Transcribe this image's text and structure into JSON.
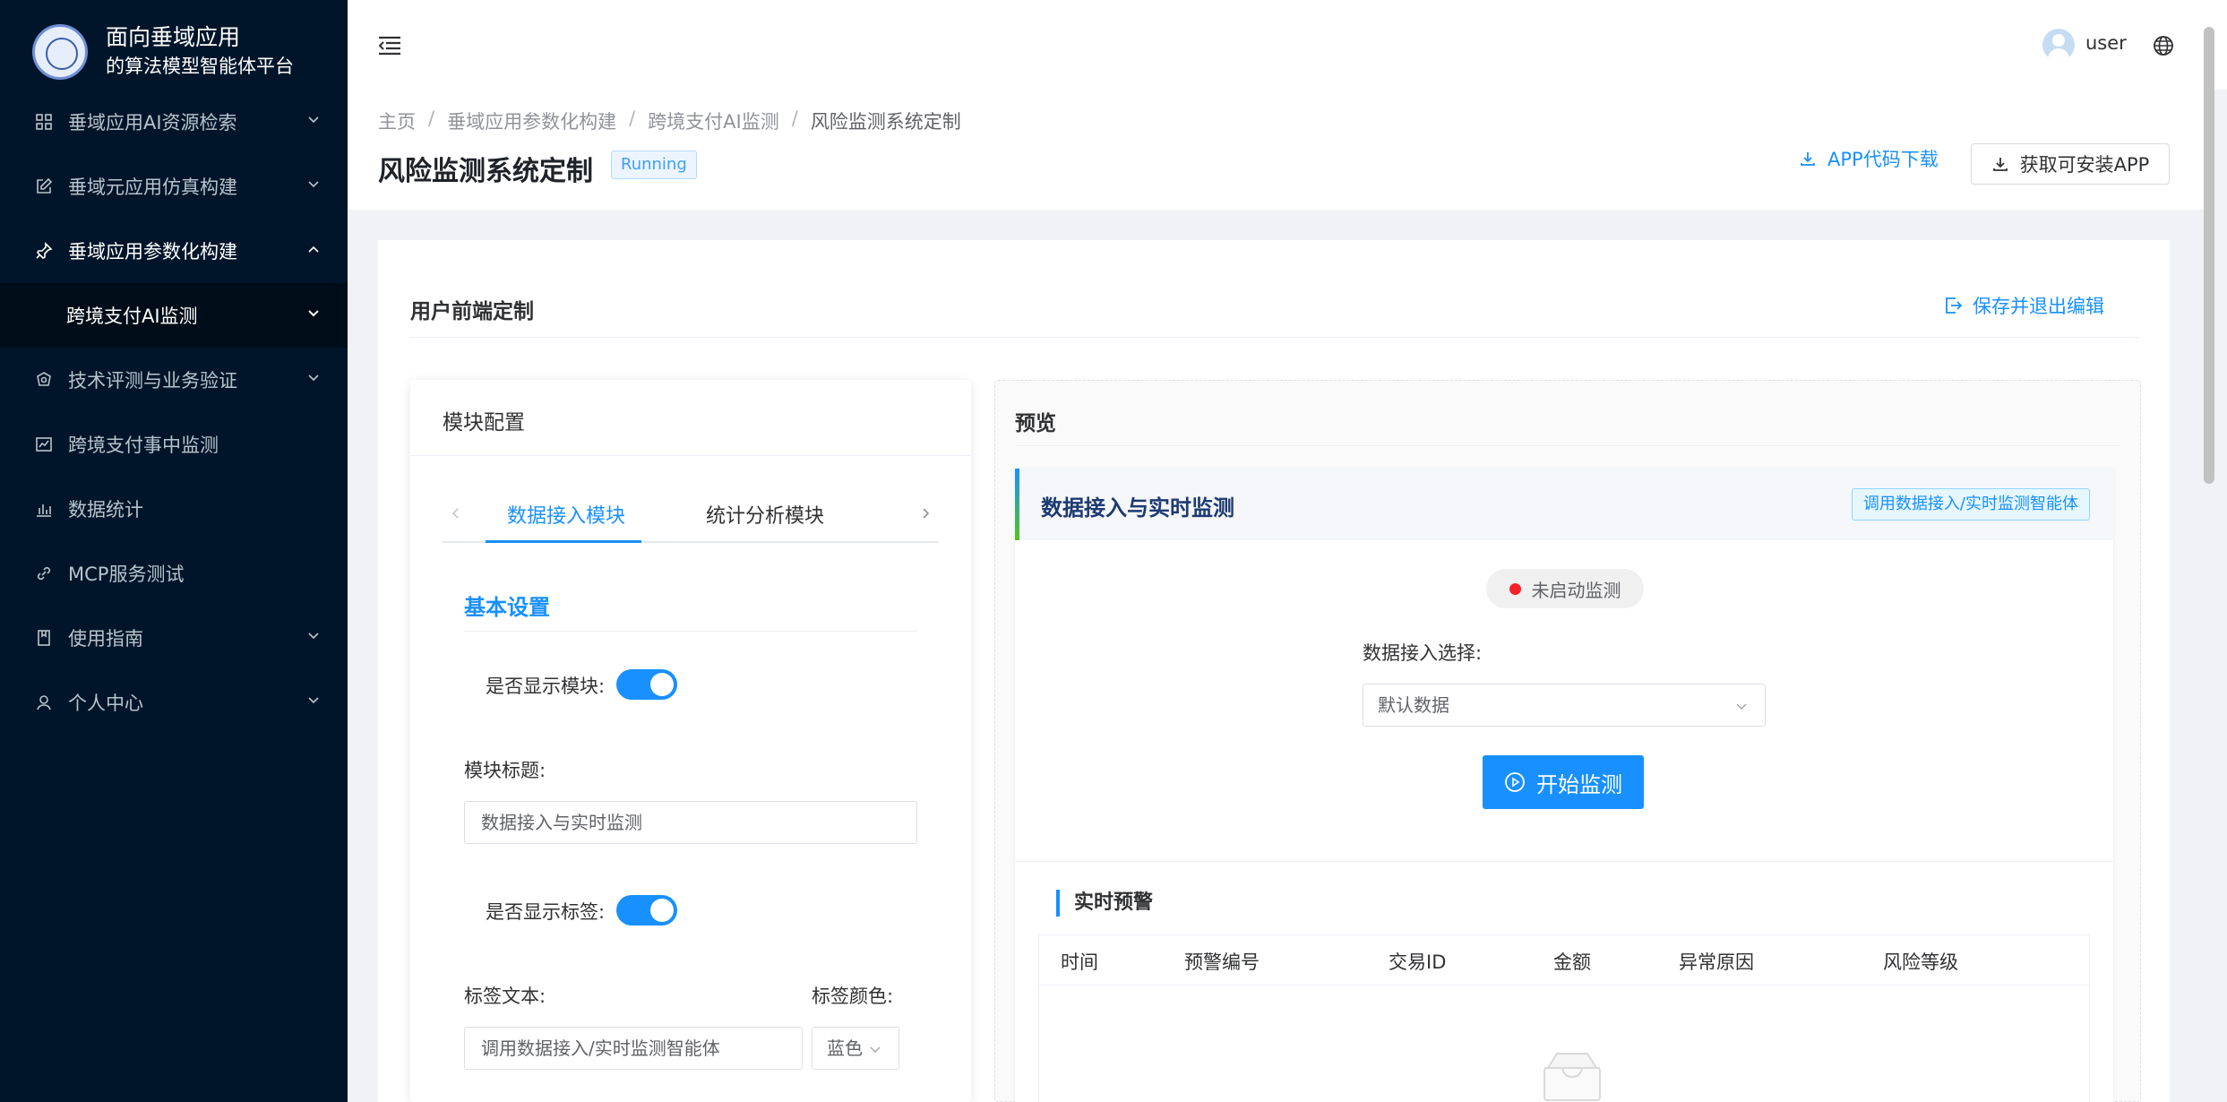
{
  "app": {
    "title_line1": "面向垂域应用",
    "title_line2": "的算法模型智能体平台"
  },
  "sidebar": {
    "items": [
      {
        "label": "垂域应用AI资源检索"
      },
      {
        "label": "垂域元应用仿真构建"
      },
      {
        "label": "垂域应用参数化构建"
      },
      {
        "label": "跨境支付AI监测"
      },
      {
        "label": "技术评测与业务验证"
      },
      {
        "label": "跨境支付事中监测"
      },
      {
        "label": "数据统计"
      },
      {
        "label": "MCP服务测试"
      },
      {
        "label": "使用指南"
      },
      {
        "label": "个人中心"
      }
    ]
  },
  "header": {
    "username": "user"
  },
  "breadcrumb": [
    "主页",
    "垂域应用参数化构建",
    "跨境支付AI监测",
    "风险监测系统定制"
  ],
  "page": {
    "title": "风险监测系统定制",
    "status": "Running",
    "download_code": "APP代码下载",
    "get_app": "获取可安装APP"
  },
  "main": {
    "section_title": "用户前端定制",
    "save_exit": "保存并退出编辑"
  },
  "config": {
    "title": "模块配置",
    "tabs": [
      "数据接入模块",
      "统计分析模块"
    ],
    "group_title": "基本设置",
    "show_module_label": "是否显示模块:",
    "module_title_label": "模块标题:",
    "module_title_value": "数据接入与实时监测",
    "show_tag_label": "是否显示标签:",
    "tag_text_label": "标签文本:",
    "tag_text_value": "调用数据接入/实时监测智能体",
    "tag_color_label": "标签颜色:",
    "tag_color_value": "蓝色"
  },
  "preview": {
    "title": "预览",
    "module_title": "数据接入与实时监测",
    "module_tag": "调用数据接入/实时监测智能体",
    "status": "未启动监测",
    "ds_label": "数据接入选择:",
    "ds_value": "默认数据",
    "start_btn": "开始监测",
    "alert_title": "实时预警",
    "columns": [
      "时间",
      "预警编号",
      "交易ID",
      "金额",
      "异常原因",
      "风险等级"
    ]
  },
  "colors": {
    "sidebar_bg": "#001529",
    "accent": "#1890ff",
    "status_dot": "#f5222d"
  }
}
